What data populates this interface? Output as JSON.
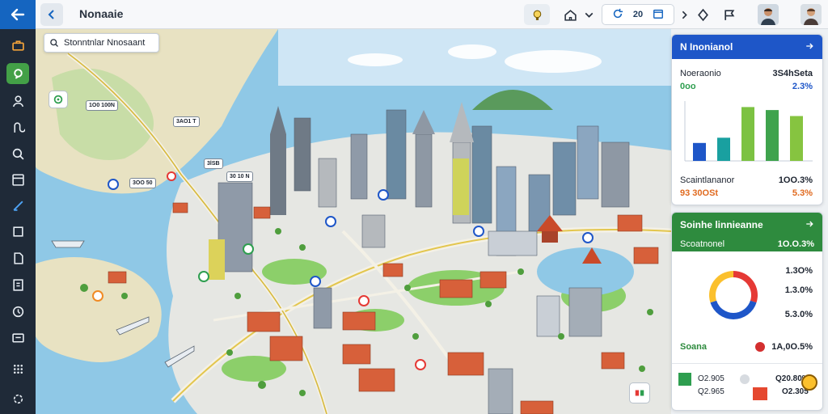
{
  "app": {
    "title": "Nonaaie"
  },
  "toolbar": {
    "group_a": "ᦓ",
    "group_b": "20"
  },
  "search": {
    "text": "Stonntnlar Nnosaant"
  },
  "map_labels": [
    "1O0  100N",
    "3AO1 T",
    "30 10 N",
    "3lSB",
    "3OO 50"
  ],
  "panel1": {
    "title": "N Inonianol",
    "metric_label": "Noeraonio",
    "metric_value": "3S4hSeta",
    "metric_sub": "0oo",
    "metric_pct": "2.3%",
    "footer_label": "Scaintlananor",
    "footer_value": "1OO.3%",
    "footer_sub": "93 30OSt",
    "footer_pct": "5.3%"
  },
  "panel2": {
    "title": "Soinhe linnieanne",
    "sub_label": "Scoatnonel",
    "sub_value": "1O.O.3%",
    "stats": [
      "1.3O%",
      "1.3.0%",
      "5.3.0%"
    ],
    "footer_label": "Soana",
    "footer_value": "1A,0O.5%",
    "bottom_a": "O2.905",
    "bottom_b": "Q2.965",
    "bottom_c": "Q20.80%",
    "bottom_d": "O2.305"
  },
  "chart_data": {
    "type": "bar",
    "values": [
      24,
      31,
      72,
      68,
      60
    ],
    "colors": [
      "#1e56c8",
      "#19a0a0",
      "#7cc242",
      "#3fa34d",
      "#86c440"
    ],
    "ylim": [
      0,
      80
    ]
  },
  "donut": {
    "segments": [
      {
        "value": 30,
        "color": "#e53935"
      },
      {
        "value": 40,
        "color": "#1e56c8"
      },
      {
        "value": 30,
        "color": "#fbc02d"
      }
    ]
  }
}
